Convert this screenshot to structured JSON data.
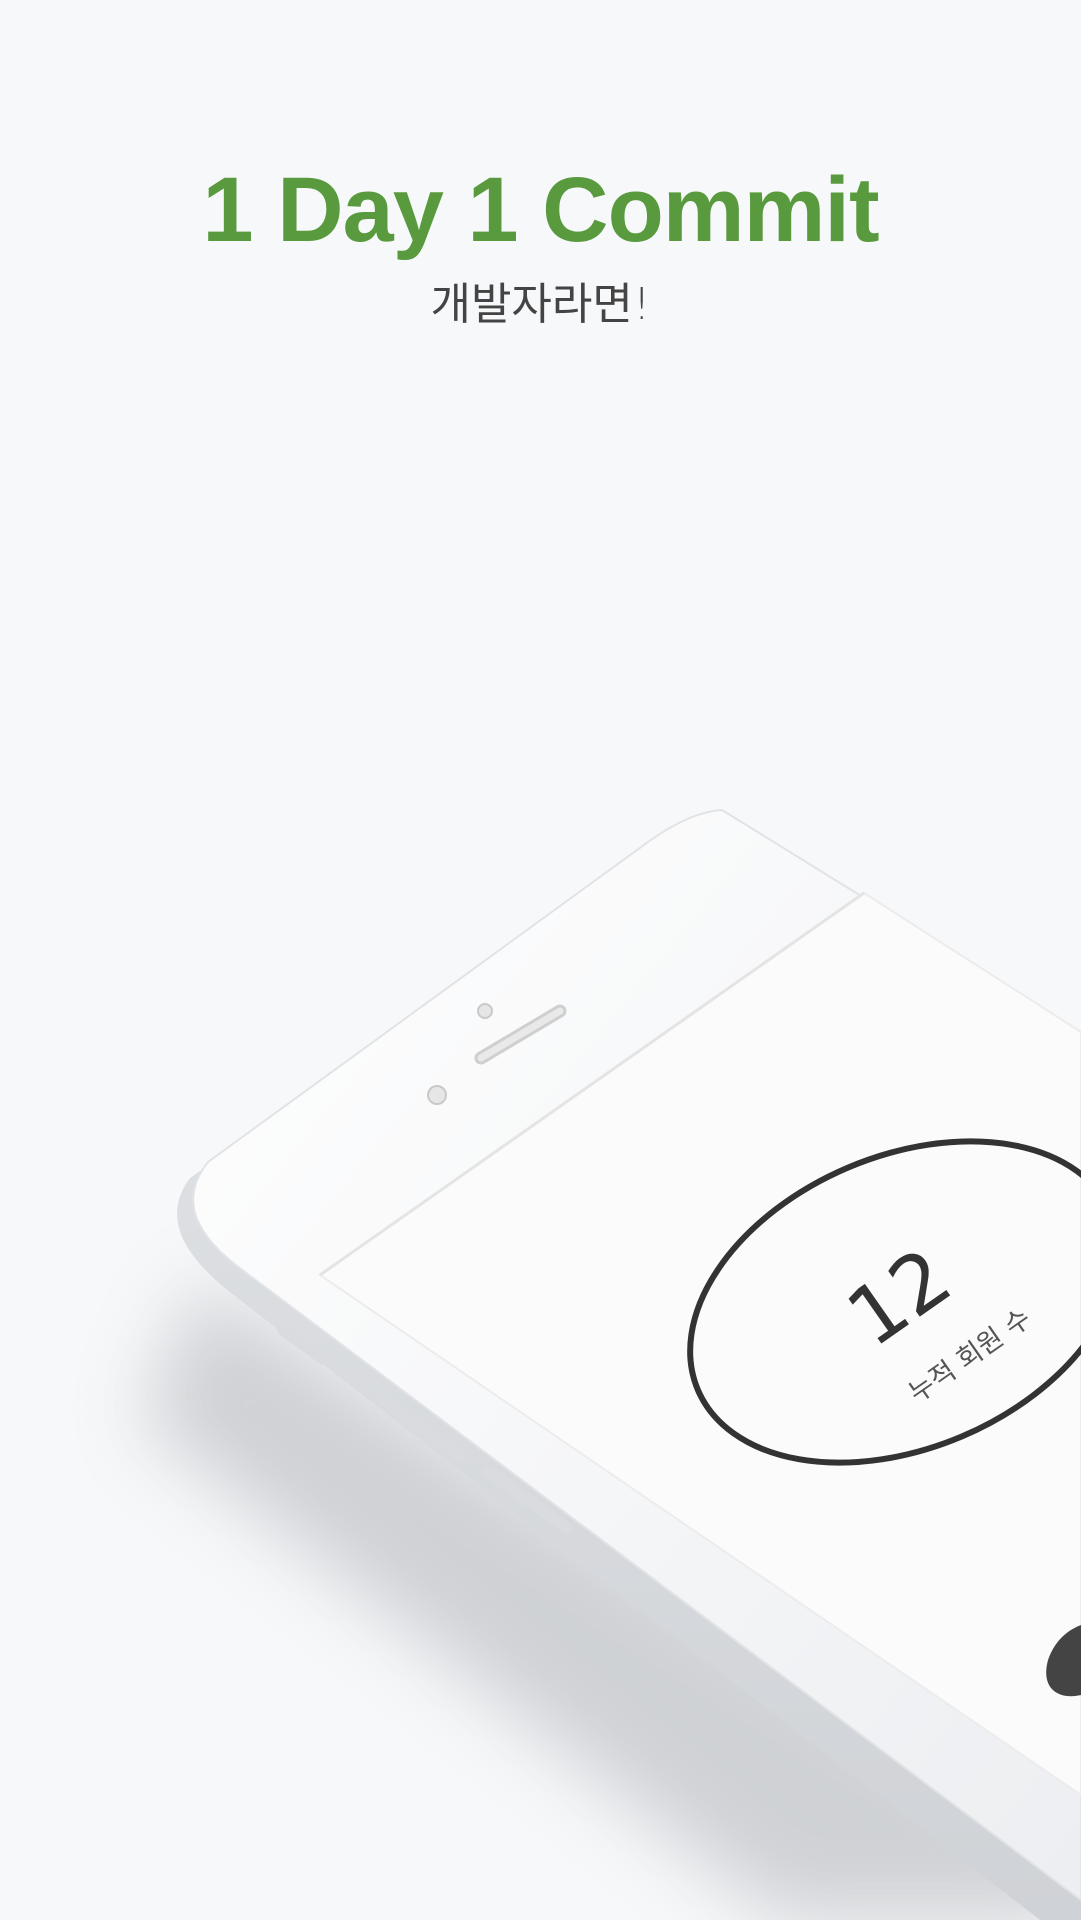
{
  "splash": {
    "title": "1 Day 1 Commit",
    "subtitle": "개발자라면!",
    "accent_color": "#5a9a3f"
  },
  "phone_screen": {
    "counter_value": "12",
    "counter_label": "누적 회원 수"
  }
}
